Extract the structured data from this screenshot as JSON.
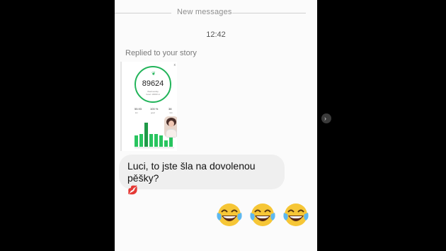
{
  "divider": {
    "label": "New messages"
  },
  "timestamp": "12:42",
  "reply_note": "Replied to your story",
  "story": {
    "steps": "89624",
    "ring_sub_1": "Wednesday",
    "ring_sub_2": "Goal: 10000 st",
    "close": "x",
    "stats": [
      {
        "value": "55.93",
        "sub": "km"
      },
      {
        "value": "100 %",
        "sub": "goal"
      },
      {
        "value": "38",
        "sub": "min"
      }
    ],
    "bar_levels": [
      0.4,
      0.45,
      0.85,
      0.45,
      0.45,
      0.4,
      0.22,
      0.33
    ],
    "bar_colors": [
      "#29c45f",
      "#29c45f",
      "#1f9a48",
      "#29c45f",
      "#29c45f",
      "#29c45f",
      "#29c45f",
      "#29c45f"
    ]
  },
  "message": {
    "text": "Luci, to jste šla na dovolenou pěšky?",
    "emoji": "💋"
  },
  "reaction_emojis": [
    "crying-laughing-face-icon",
    "crying-laughing-face-icon",
    "crying-laughing-face-icon"
  ],
  "nav": {
    "label": "›"
  },
  "colors": {
    "accent": "#22b45a",
    "bubble": "#efefef",
    "emoji_yellow": "#f6c636"
  }
}
